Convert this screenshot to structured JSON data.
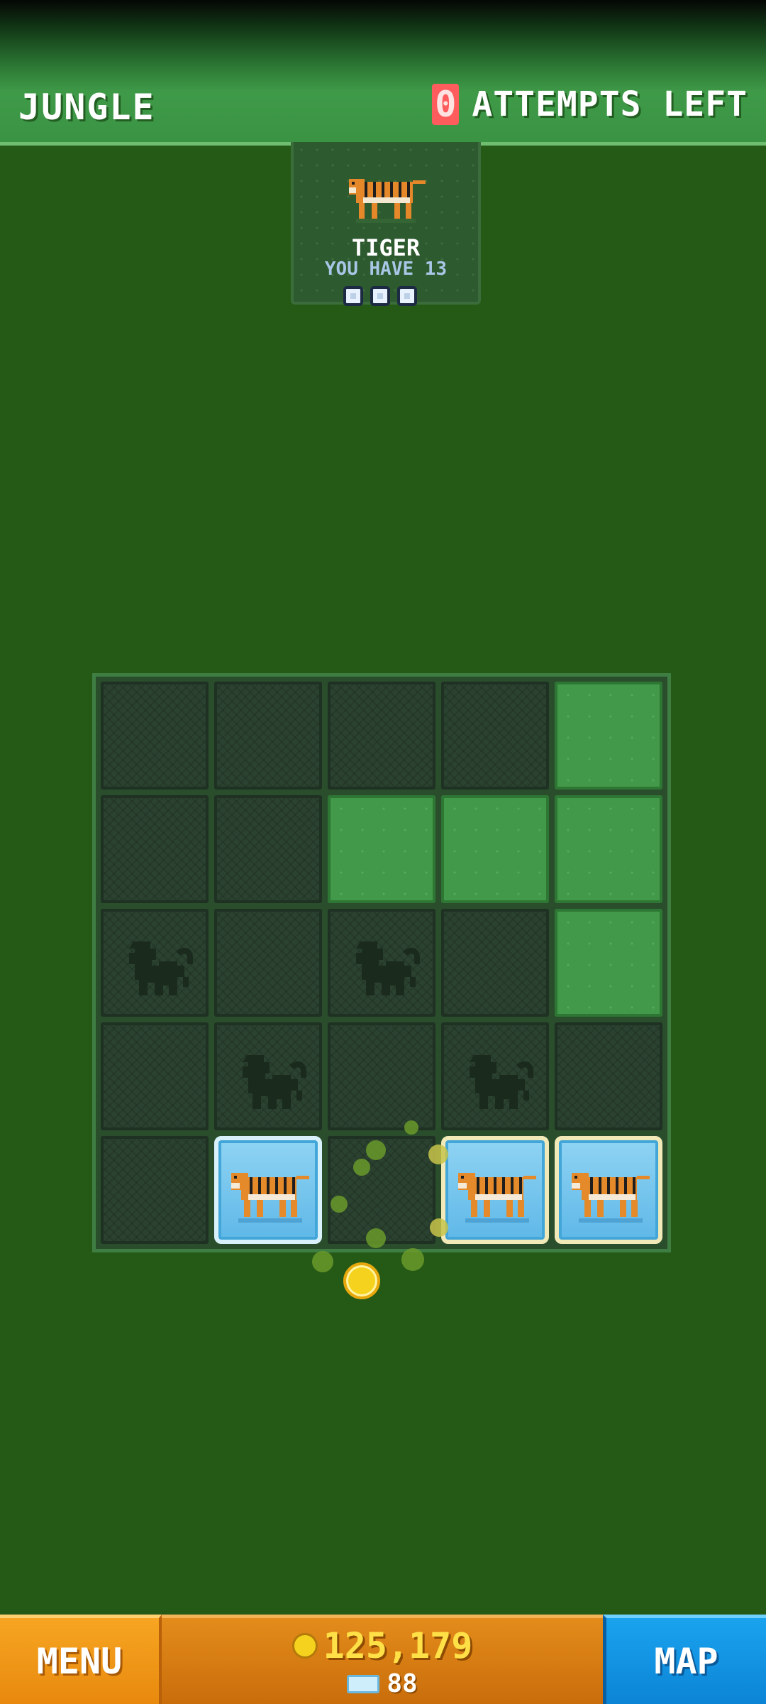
{
  "header": {
    "level_name": "JUNGLE",
    "attempts_count": "0",
    "attempts_label": "ATTEMPTS LEFT"
  },
  "target": {
    "animal_name": "TIGER",
    "you_have": "YOU HAVE 13",
    "progress_slots": 3
  },
  "board": {
    "rows": [
      [
        "dark",
        "dark",
        "dark",
        "dark",
        "grass"
      ],
      [
        "dark",
        "dark",
        "grass",
        "grass",
        "grass"
      ],
      [
        "monkey-silhouette",
        "dark",
        "monkey-silhouette",
        "dark",
        "grass"
      ],
      [
        "dark",
        "monkey-silhouette",
        "dark",
        "monkey-silhouette",
        "dark"
      ],
      [
        "dark",
        "tiger",
        "dark",
        "tiger",
        "tiger"
      ]
    ]
  },
  "footer": {
    "menu_label": "MENU",
    "coins": "125,179",
    "gems": "88",
    "map_label": "MAP"
  },
  "colors": {
    "background": "#255a16",
    "header": "#3f9a48",
    "grass_tile": "#43994a",
    "dark_tile": "#2b4230",
    "menu": "#f7a523",
    "wallet": "#e38c1b",
    "map": "#1aa3ee",
    "coin": "#f5d21e"
  }
}
